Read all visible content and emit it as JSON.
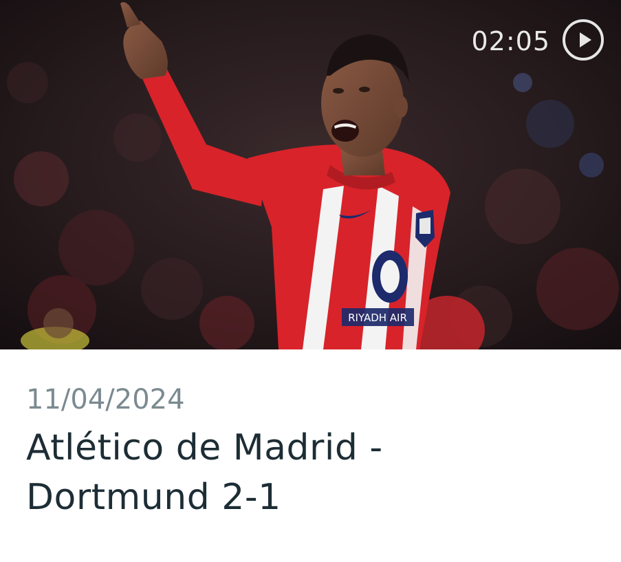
{
  "video": {
    "duration": "02:05",
    "thumbnail_alt": "Player celebrating in red and white striped kit",
    "shirt_sponsor": "RIYADH AIR"
  },
  "article": {
    "date": "11/04/2024",
    "title": "Atlético de Madrid - Dortmund 2-1"
  },
  "colors": {
    "date": "#7b8a91",
    "title": "#1d2d35",
    "overlay_text": "#e9e9e9",
    "kit_red": "#d8232a"
  },
  "icons": {
    "play": "play-circle-icon"
  }
}
